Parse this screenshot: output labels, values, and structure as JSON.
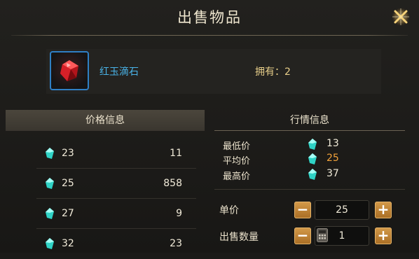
{
  "window": {
    "title": "出售物品"
  },
  "item": {
    "name": "红玉滴石",
    "owned_label": "拥有：",
    "owned_count": "2"
  },
  "price_panel": {
    "header": "价格信息",
    "rows": [
      {
        "price": "23",
        "qty": "11"
      },
      {
        "price": "25",
        "qty": "858"
      },
      {
        "price": "27",
        "qty": "9"
      },
      {
        "price": "32",
        "qty": "23"
      }
    ]
  },
  "market_panel": {
    "header": "行情信息",
    "stats": [
      {
        "label": "最低价",
        "value": "13"
      },
      {
        "label": "平均价",
        "value": "25"
      },
      {
        "label": "最高价",
        "value": "37"
      }
    ]
  },
  "controls": {
    "unit_price_label": "单价",
    "unit_price_value": "25",
    "quantity_label": "出售数量",
    "quantity_value": "1",
    "minus": "−",
    "plus": "+"
  },
  "colors": {
    "accent_gold": "#f2a23a",
    "item_name": "#49b3e8",
    "gem": "#2fd3c6"
  },
  "icons": [
    "close-icon",
    "ruby-gem-icon",
    "jade-gem-icon",
    "calculator-icon"
  ]
}
